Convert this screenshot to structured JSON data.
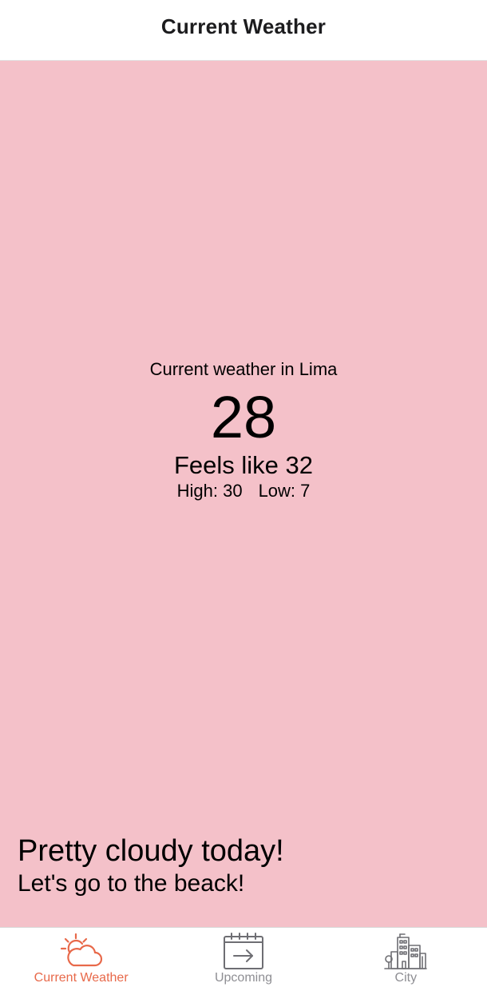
{
  "header": {
    "title": "Current Weather"
  },
  "weather": {
    "location_text": "Current weather in Lima",
    "temperature": "28",
    "feels_like": "Feels like 32",
    "high": "High: 30",
    "low": "Low: 7"
  },
  "message": {
    "title": "Pretty cloudy today!",
    "subtitle": "Let's go to the beack!"
  },
  "tabs": [
    {
      "label": "Current Weather",
      "icon": "partly-cloudy-icon",
      "active": true
    },
    {
      "label": "Upcoming",
      "icon": "calendar-arrow-icon",
      "active": false
    },
    {
      "label": "City",
      "icon": "city-buildings-icon",
      "active": false
    }
  ],
  "colors": {
    "background": "#f4c1c9",
    "accent": "#e8694a",
    "inactive": "#8e8e93"
  }
}
